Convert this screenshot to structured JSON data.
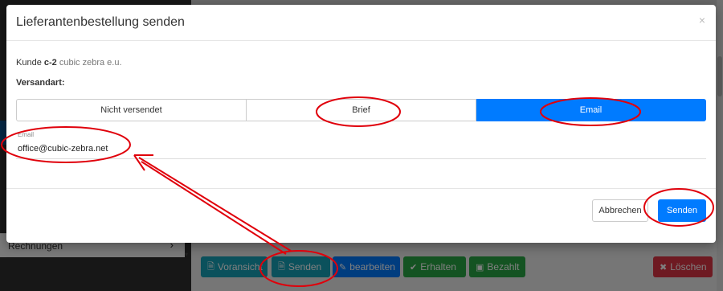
{
  "background": {
    "sidebar_item": "Rechnungen",
    "actions": [
      {
        "label": "Voransicht",
        "icon": "file-pdf-icon",
        "color": "#17a2b8"
      },
      {
        "label": "Senden",
        "icon": "file-pdf-icon",
        "color": "#17a2b8"
      },
      {
        "label": "bearbeiten",
        "icon": "pencil-icon",
        "color": "#007bff"
      },
      {
        "label": "Erhalten",
        "icon": "check-icon",
        "color": "#28a745"
      },
      {
        "label": "Bezahlt",
        "icon": "money-icon",
        "color": "#28a745"
      },
      {
        "label": "Löschen",
        "icon": "times-icon",
        "color": "#dc3545"
      }
    ]
  },
  "modal": {
    "title": "Lieferantenbestellung senden",
    "close_glyph": "×",
    "customer_prefix": "Kunde",
    "customer_code": "c-2",
    "customer_name": "cubic zebra e.u.",
    "shipping_label": "Versandart:",
    "shipping_options": [
      {
        "label": "Nicht versendet",
        "active": false
      },
      {
        "label": "Brief",
        "active": false
      },
      {
        "label": "Email",
        "active": true
      }
    ],
    "email_label": "Email",
    "email_value": "office@cubic-zebra.net",
    "cancel_label": "Abbrechen",
    "submit_label": "Senden"
  },
  "colors": {
    "primary": "#007bff",
    "info": "#17a2b8",
    "success": "#28a745",
    "danger": "#dc3545",
    "annotation": "#e0000b"
  }
}
